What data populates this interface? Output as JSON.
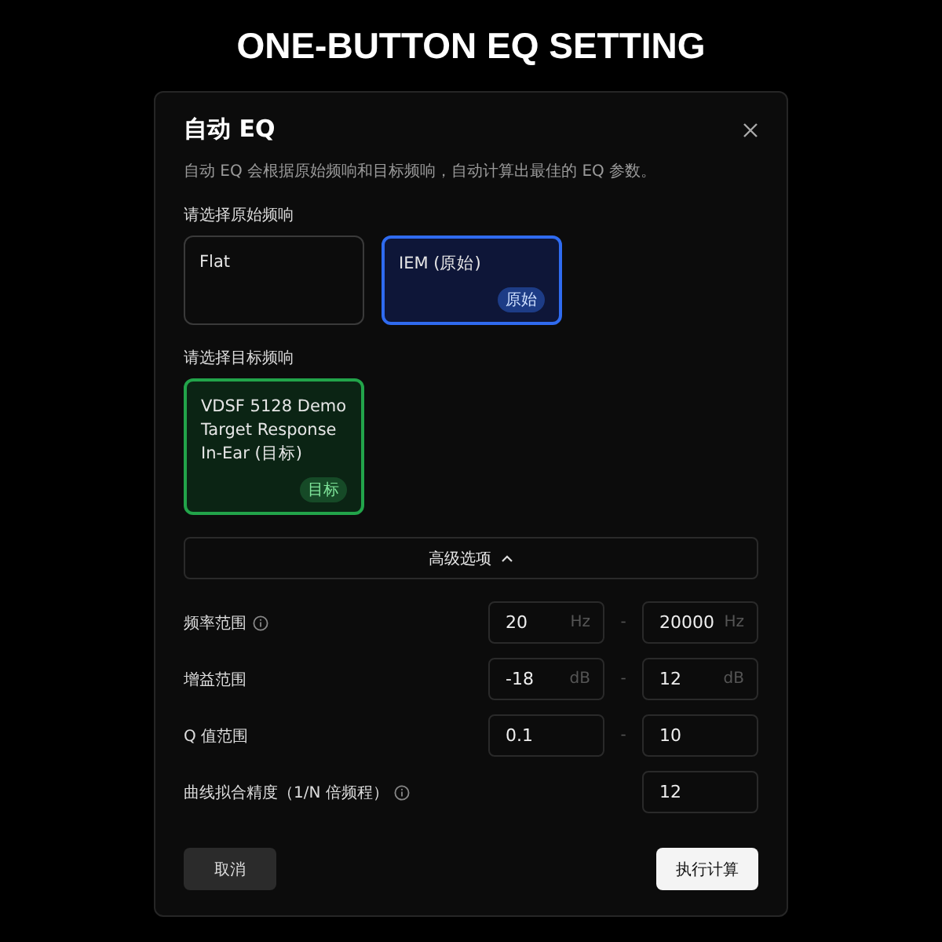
{
  "banner": {
    "title": "ONE-BUTTON EQ SETTING"
  },
  "dialog": {
    "title": "自动 EQ",
    "description": "自动 EQ 会根据原始频响和目标频响，自动计算出最佳的 EQ 参数。",
    "sections": [
      {
        "kind": "source",
        "label": "请选择原始频响",
        "options": [
          {
            "label": "Flat",
            "selected": false
          },
          {
            "label": "IEM (原始)",
            "selected": true,
            "badge": "原始"
          }
        ]
      },
      {
        "kind": "target",
        "label": "请选择目标频响",
        "options": [
          {
            "label": "VDSF 5128 Demo Target Response In-Ear (目标)",
            "selected": true,
            "badge": "目标"
          }
        ]
      }
    ],
    "advanced": {
      "label": "高级选项",
      "expanded": true
    },
    "rows": [
      {
        "kind": "range",
        "label": "频率范围",
        "info": true,
        "min": {
          "value": "20",
          "unit": "Hz"
        },
        "separator": "-",
        "max": {
          "value": "20000",
          "unit": "Hz"
        }
      },
      {
        "kind": "range",
        "label": "增益范围",
        "info": false,
        "min": {
          "value": "-18",
          "unit": "dB"
        },
        "separator": "-",
        "max": {
          "value": "12",
          "unit": "dB"
        }
      },
      {
        "kind": "range",
        "label": "Q 值范围",
        "info": false,
        "min": {
          "value": "0.1"
        },
        "separator": "-",
        "max": {
          "value": "10"
        }
      },
      {
        "kind": "single",
        "label": "曲线拟合精度（1/N 倍频程）",
        "info": true,
        "max": {
          "value": "12"
        }
      }
    ],
    "buttons": {
      "cancel": "取消",
      "run": "执行计算"
    }
  }
}
